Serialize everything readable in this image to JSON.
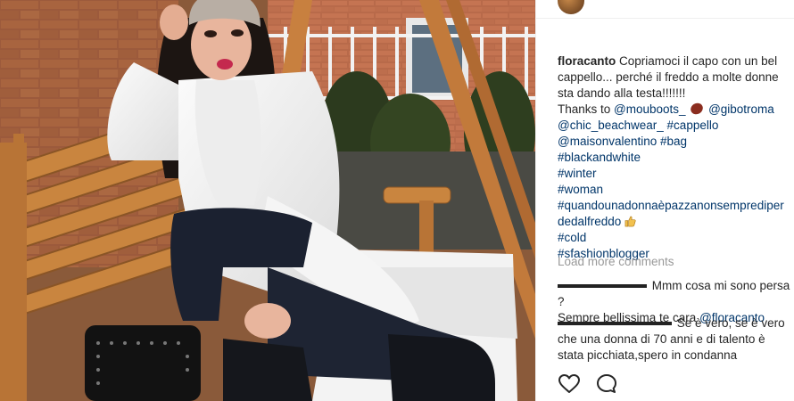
{
  "post": {
    "username": "floracanto",
    "caption_l1": "Copriamoci il capo con un bel",
    "caption_l2": "cappello... perché il freddo a molte donne",
    "caption_l3": "sta dando alla testa!!!!!!!",
    "thanks_to": "Thanks to",
    "mention_mouboots": "@mouboots_",
    "mention_gibotroma": "@gibotroma",
    "mention_chic": "@chic_beachwear_",
    "tag_cappello": "#cappello",
    "mention_maison": "@maisonvalentino",
    "tag_bag": "#bag",
    "tag_blackandwhite": "#blackandwhite",
    "tag_winter": "#winter",
    "tag_woman": "#woman",
    "tag_quando_l1": "#quandounadonnaèpazzanonsemprediper",
    "tag_quando_l2": "dedalfreddo",
    "tag_cold": "#cold",
    "tag_sfashion": "#sfashionblogger"
  },
  "load_more": "Load more comments",
  "comments": [
    {
      "text_l1": "Mmm cosa mi sono persa ?",
      "text_l2": "Sempre bellissima te cara",
      "mention": "@floracanto"
    },
    {
      "text_l1": "Se è vero, se è vero",
      "text_l2": "che una donna di 70 anni e di talento è",
      "text_l3": "stata picchiata,spero in condanna"
    }
  ],
  "icons": {
    "like": "heart-icon",
    "comment": "comment-bubble-icon"
  },
  "colors": {
    "mention_link": "#003569",
    "muted": "#999999"
  }
}
